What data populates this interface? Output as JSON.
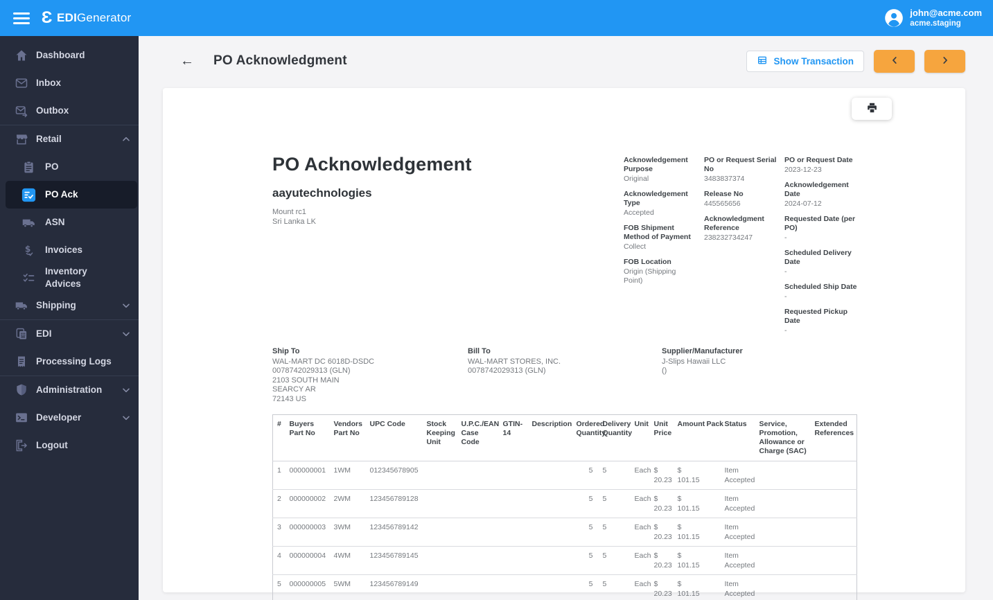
{
  "topbar": {
    "brand_bold": "EDI",
    "brand_light": "Generator",
    "user_email": "john@acme.com",
    "user_org": "acme.staging"
  },
  "sidebar": {
    "items": [
      {
        "id": "dashboard",
        "label": "Dashboard",
        "icon": "home",
        "indent": 0
      },
      {
        "id": "inbox",
        "label": "Inbox",
        "icon": "inbox",
        "indent": 0
      },
      {
        "id": "outbox",
        "label": "Outbox",
        "icon": "outbox",
        "indent": 0,
        "divider_after": true
      },
      {
        "id": "retail",
        "label": "Retail",
        "icon": "retail",
        "indent": 0,
        "chevron": "up"
      },
      {
        "id": "po",
        "label": "PO",
        "icon": "po",
        "indent": 1
      },
      {
        "id": "po-ack",
        "label": "PO Ack",
        "icon": "po-ack",
        "indent": 1,
        "active": true
      },
      {
        "id": "asn",
        "label": "ASN",
        "icon": "truck",
        "indent": 1
      },
      {
        "id": "invoices",
        "label": "Invoices",
        "icon": "invoices",
        "indent": 1
      },
      {
        "id": "inventory-advices",
        "label": "Inventory Advices",
        "icon": "inventory",
        "indent": 1
      },
      {
        "id": "shipping",
        "label": "Shipping",
        "icon": "truck",
        "indent": 0,
        "chevron": "down",
        "divider_after": true
      },
      {
        "id": "edi",
        "label": "EDI",
        "icon": "edi",
        "indent": 0,
        "chevron": "down"
      },
      {
        "id": "processing-logs",
        "label": "Processing Logs",
        "icon": "logs",
        "indent": 0,
        "divider_after": true
      },
      {
        "id": "administration",
        "label": "Administration",
        "icon": "admin",
        "indent": 0,
        "chevron": "down"
      },
      {
        "id": "developer",
        "label": "Developer",
        "icon": "developer",
        "indent": 0,
        "chevron": "down"
      },
      {
        "id": "logout",
        "label": "Logout",
        "icon": "logout",
        "indent": 0
      }
    ]
  },
  "page_header": {
    "title": "PO Acknowledgment",
    "show_transaction": "Show Transaction"
  },
  "document": {
    "title": "PO Acknowledgement",
    "company": "aayutechnologies",
    "company_address": [
      "Mount rc1",
      "Sri Lanka LK"
    ],
    "info_columns": [
      [
        {
          "label": "Acknowledgement Purpose",
          "value": "Original"
        },
        {
          "label": "Acknowledgement Type",
          "value": "Accepted"
        },
        {
          "label": "FOB Shipment Method of Payment",
          "value": "Collect"
        },
        {
          "label": "FOB Location",
          "value": "Origin (Shipping Point)"
        }
      ],
      [
        {
          "label": "PO or Request Serial No",
          "value": "3483837374"
        },
        {
          "label": "Release No",
          "value": "445565656"
        },
        {
          "label": "Acknowledgment Reference",
          "value": "238232734247"
        }
      ],
      [
        {
          "label": "PO or Request Date",
          "value": "2023-12-23"
        },
        {
          "label": "Acknowledgement Date",
          "value": "2024-07-12"
        },
        {
          "label": "Requested Date (per PO)",
          "value": "-"
        },
        {
          "label": "Scheduled Delivery Date",
          "value": "-"
        },
        {
          "label": "Scheduled Ship Date",
          "value": "-"
        },
        {
          "label": "Requested Pickup Date",
          "value": "-"
        }
      ]
    ],
    "parties": [
      {
        "label": "Ship To",
        "lines": [
          "WAL-MART DC 6018D-DSDC",
          "0078742029313 (GLN)",
          "2103 SOUTH MAIN",
          "SEARCY AR",
          "72143 US"
        ]
      },
      {
        "label": "Bill To",
        "lines": [
          "WAL-MART STORES, INC.",
          "0078742029313 (GLN)"
        ]
      },
      {
        "label": "Supplier/Manufacturer",
        "lines": [
          "J-Slips Hawaii LLC",
          "()"
        ]
      }
    ],
    "table": {
      "headers": [
        "#",
        "Buyers Part No",
        "Vendors Part No",
        "UPC Code",
        "Stock Keeping Unit",
        "U.P.C./EAN Case Code",
        "GTIN-14",
        "Description",
        "Ordered Quantity",
        "Delivery Quantity",
        "Unit",
        "Unit Price",
        "Amount",
        "Pack",
        "Status",
        "Service, Promotion, Allowance or Charge (SAC)",
        "Extended References"
      ],
      "rows": [
        [
          "1",
          "000000001",
          "1WM",
          "012345678905",
          "",
          "",
          "",
          "",
          "5",
          "5",
          "Each",
          "$ 20.23",
          "$ 101.15",
          "",
          "Item Accepted",
          "",
          ""
        ],
        [
          "2",
          "000000002",
          "2WM",
          "123456789128",
          "",
          "",
          "",
          "",
          "5",
          "5",
          "Each",
          "$ 20.23",
          "$ 101.15",
          "",
          "Item Accepted",
          "",
          ""
        ],
        [
          "3",
          "000000003",
          "3WM",
          "123456789142",
          "",
          "",
          "",
          "",
          "5",
          "5",
          "Each",
          "$ 20.23",
          "$ 101.15",
          "",
          "Item Accepted",
          "",
          ""
        ],
        [
          "4",
          "000000004",
          "4WM",
          "123456789145",
          "",
          "",
          "",
          "",
          "5",
          "5",
          "Each",
          "$ 20.23",
          "$ 101.15",
          "",
          "Item Accepted",
          "",
          ""
        ],
        [
          "5",
          "000000005",
          "5WM",
          "123456789149",
          "",
          "",
          "",
          "",
          "5",
          "5",
          "Each",
          "$ 20.23",
          "$ 101.15",
          "",
          "Item Accepted",
          "",
          ""
        ]
      ]
    }
  },
  "colors": {
    "topbar_blue": "#2196f3",
    "accent_orange": "#f6a53e",
    "sidebar_bg": "#262c3c",
    "sidebar_active_bg": "#171c29"
  }
}
